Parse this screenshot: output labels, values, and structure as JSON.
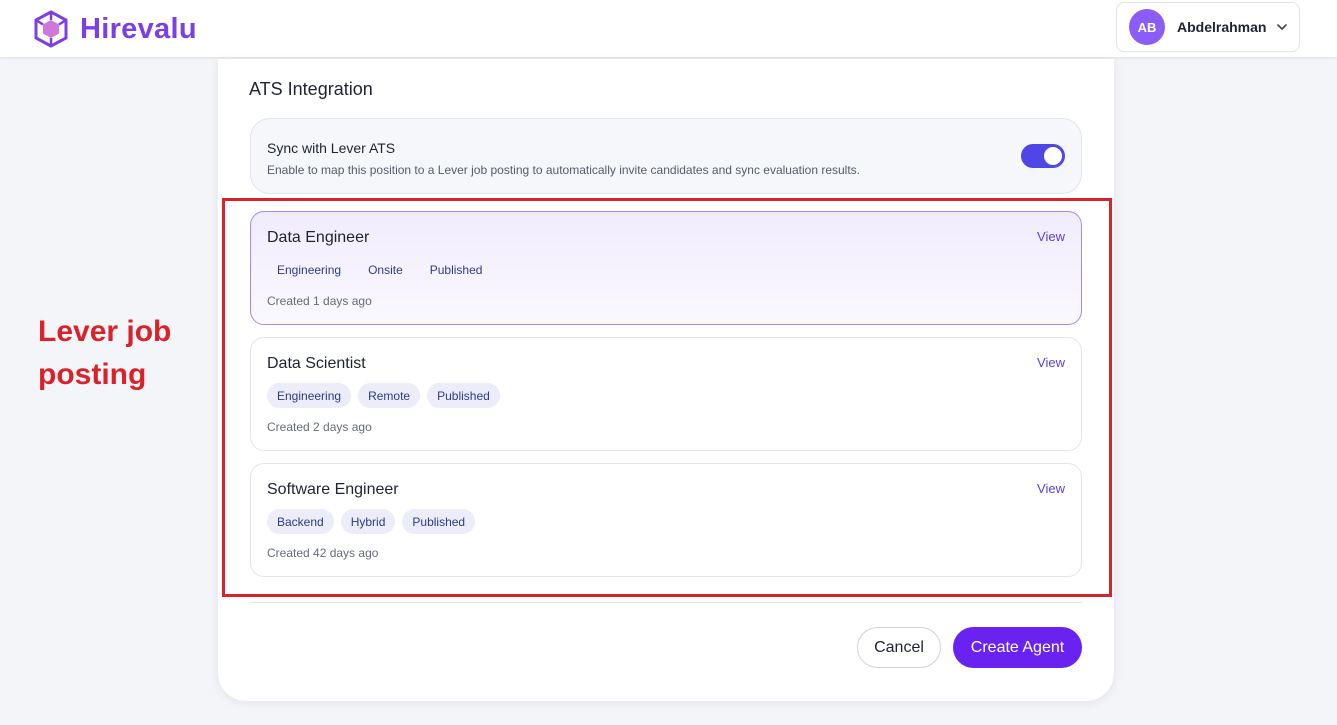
{
  "app": {
    "brand_name": "Hirevalu",
    "brand_color": "#7c3fe4",
    "logo_icon": "cube-logo-icon"
  },
  "user": {
    "initials": "AB",
    "name": "Abdelrahman",
    "menu_icon": "chevron-down-icon"
  },
  "ats": {
    "section_title": "ATS Integration",
    "sync_title": "Sync with Lever ATS",
    "sync_description": "Enable to map this position to a Lever job posting to automatically invite candidates and sync evaluation results.",
    "sync_enabled": true,
    "toggle_color": "#4f46e5"
  },
  "jobs": [
    {
      "title": "Data Engineer",
      "view_label": "View",
      "tags": [
        "Engineering",
        "Onsite",
        "Published"
      ],
      "created": "Created 1 days ago",
      "selected": true
    },
    {
      "title": "Data Scientist",
      "view_label": "View",
      "tags": [
        "Engineering",
        "Remote",
        "Published"
      ],
      "created": "Created 2 days ago",
      "selected": false
    },
    {
      "title": "Software Engineer",
      "view_label": "View",
      "tags": [
        "Backend",
        "Hybrid",
        "Published"
      ],
      "created": "Created 42 days ago",
      "selected": false
    }
  ],
  "actions": {
    "cancel_label": "Cancel",
    "create_label": "Create Agent",
    "create_color": "#6a22f0"
  },
  "annotation": {
    "label": "Lever job posting",
    "color": "#d8232a"
  }
}
